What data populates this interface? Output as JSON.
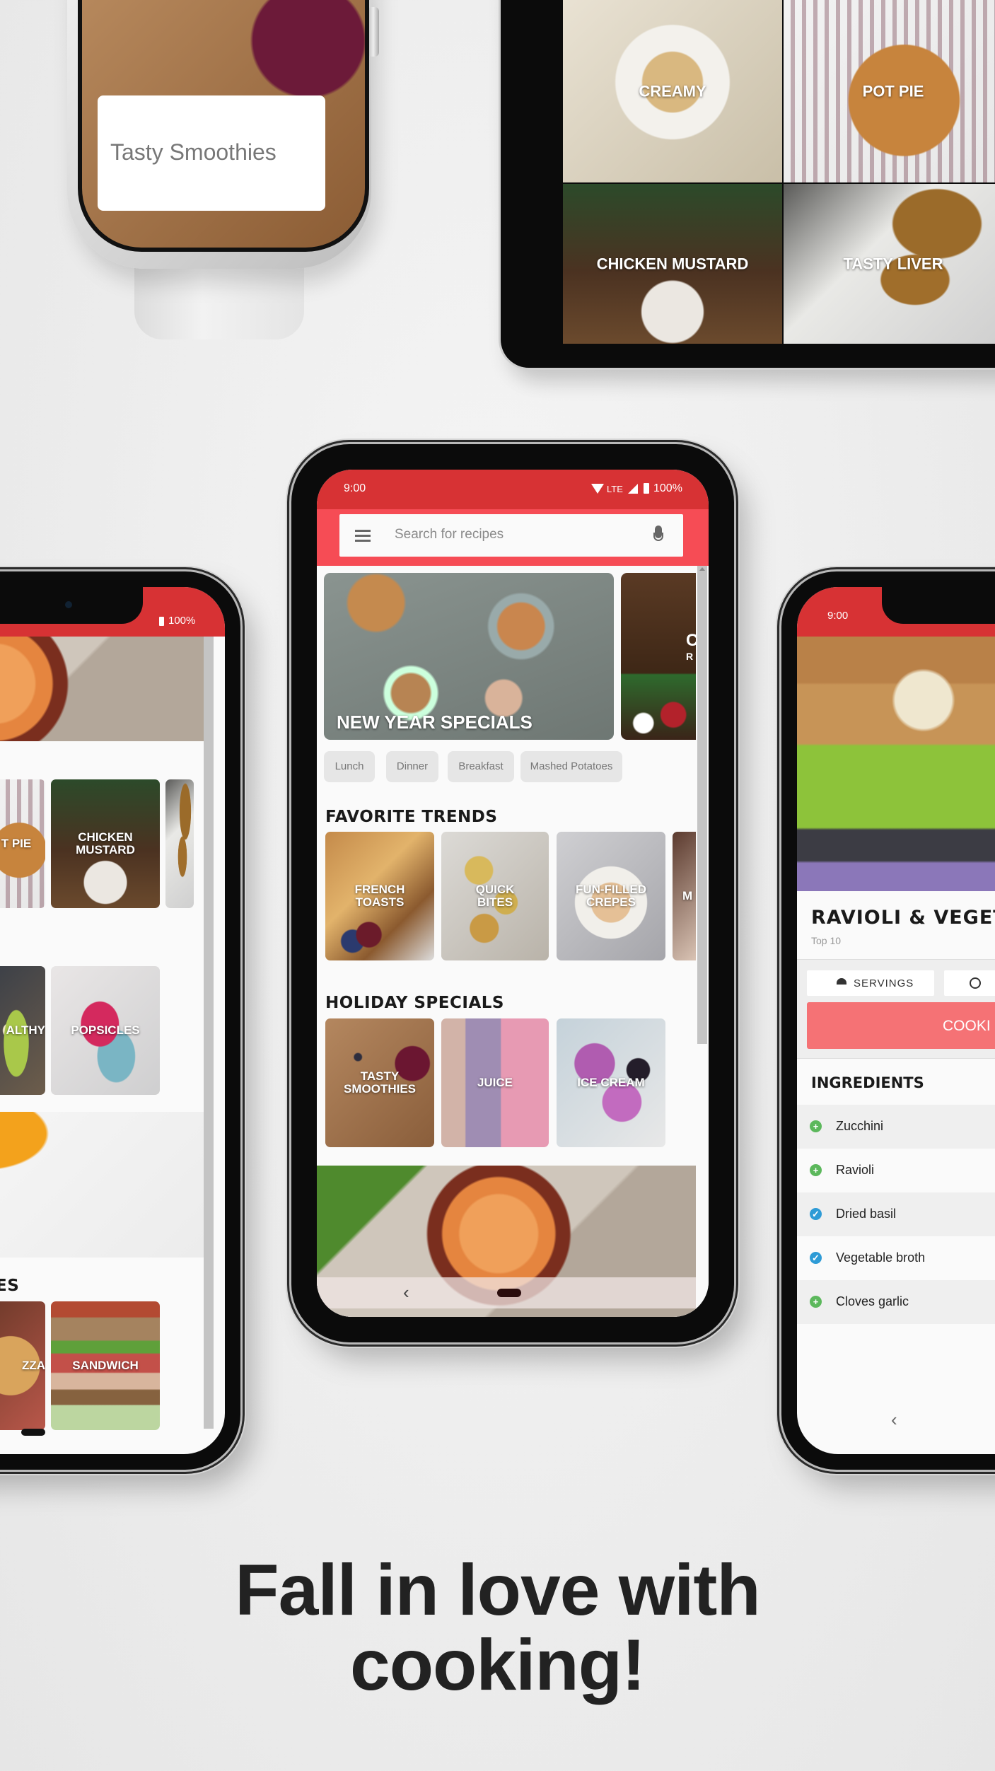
{
  "watch": {
    "card_label": "Tasty Smoothies"
  },
  "tablet": {
    "tiles": [
      {
        "label": "Creamy"
      },
      {
        "label": "Pot Pie"
      },
      {
        "label": "Chicken Mustard"
      },
      {
        "label": "Tasty Liver"
      }
    ]
  },
  "center_phone": {
    "status": {
      "time": "9:00",
      "network": "LTE",
      "battery": "100%"
    },
    "search": {
      "placeholder": "Search for recipes"
    },
    "banner": {
      "title": "New Year Specials",
      "next_partial": "C",
      "next_partial_sub": "R"
    },
    "chips": [
      "Lunch",
      "Dinner",
      "Breakfast",
      "Mashed Potatoes"
    ],
    "favorite_trends": {
      "title": "FAVORITE TRENDS",
      "items": [
        {
          "label": "French Toasts"
        },
        {
          "label": "Quick Bites"
        },
        {
          "label": "Fun-Filled Crepes"
        },
        {
          "label": "M"
        }
      ]
    },
    "holiday_specials": {
      "title": "HOLIDAY SPECIALS",
      "items": [
        {
          "label": "Tasty Smoothies"
        },
        {
          "label": "Juice"
        },
        {
          "label": "Ice Cream"
        }
      ]
    },
    "nav": {
      "back": "‹"
    }
  },
  "left_phone": {
    "status": {
      "battery": "100%"
    },
    "row1": [
      {
        "label": "T PIE"
      },
      {
        "label": "Chicken Mustard"
      }
    ],
    "row2": [
      {
        "label": "ALTHY"
      },
      {
        "label": "Popsicles"
      }
    ],
    "section_partial": "ES",
    "row3": [
      {
        "label": "ZZA"
      },
      {
        "label": "Sandwich"
      }
    ]
  },
  "right_phone": {
    "status": {
      "time": "9:00"
    },
    "recipe": {
      "title": "RAVIOLI & VEGETA",
      "subtitle": "Top 10",
      "servings_label": "SERVINGS",
      "cooking_button": "COOKI"
    },
    "ingredients": {
      "title": "INGREDIENTS",
      "items": [
        {
          "name": "Zucchini",
          "state": "add"
        },
        {
          "name": "Ravioli",
          "state": "add"
        },
        {
          "name": "Dried basil",
          "state": "checked"
        },
        {
          "name": "Vegetable broth",
          "state": "checked"
        },
        {
          "name": "Cloves garlic",
          "state": "add"
        }
      ]
    },
    "nav": {
      "back": "‹"
    }
  },
  "tagline": {
    "line1": "Fall in love with",
    "line2": "cooking!"
  },
  "colors": {
    "status_red": "#d73234",
    "header_red": "#f64c55",
    "cook_button": "#f57275",
    "add_green": "#5cb85c",
    "check_blue": "#2e9bd6"
  }
}
